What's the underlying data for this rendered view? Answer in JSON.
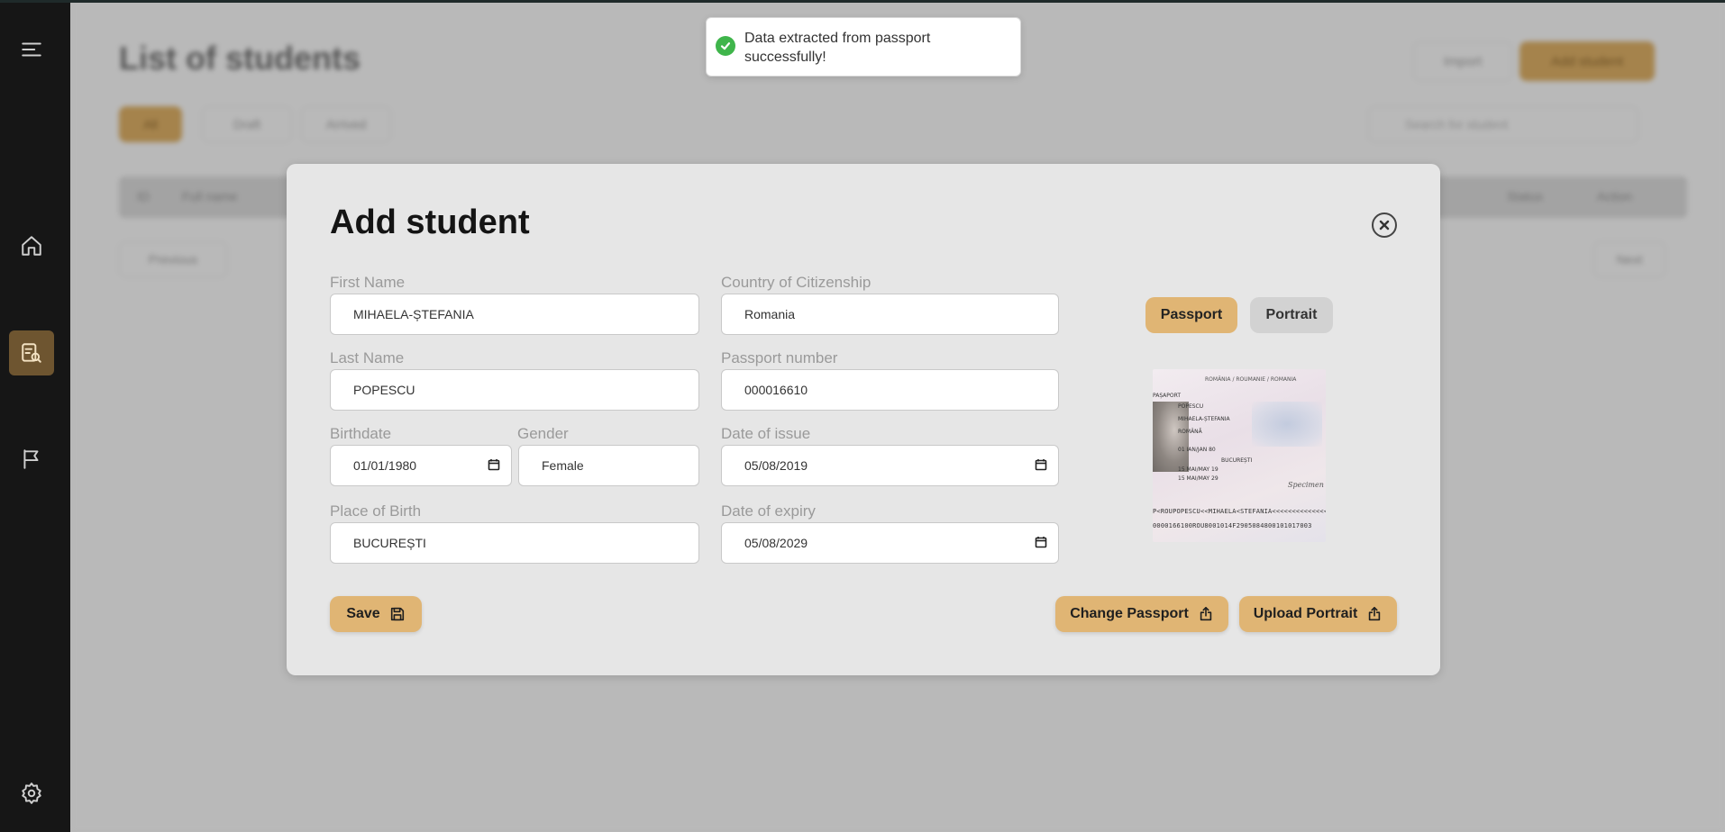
{
  "background": {
    "title": "List of students",
    "import_label": "Import",
    "add_student_label": "Add student",
    "tabs": [
      "All",
      "Draft",
      "Arrived"
    ],
    "search_placeholder": "Search for student",
    "table_headers": [
      "ID",
      "Full name",
      "Status",
      "Action"
    ],
    "row_button": "Previous",
    "pager": "Next"
  },
  "toast": {
    "message": "Data extracted from passport successfully!",
    "icon": "check-circle-icon",
    "icon_color": "#3fb54b"
  },
  "modal": {
    "title": "Add student",
    "fields": {
      "first_name": {
        "label": "First Name",
        "value": "MIHAELA-ȘTEFANIA"
      },
      "last_name": {
        "label": "Last Name",
        "value": "POPESCU"
      },
      "birthdate": {
        "label": "Birthdate",
        "value": "01/01/1980"
      },
      "gender": {
        "label": "Gender",
        "value": "Female"
      },
      "place_of_birth": {
        "label": "Place of Birth",
        "value": "BUCUREȘTI"
      },
      "country": {
        "label": "Country of Citizenship",
        "value": "Romania"
      },
      "passport_number": {
        "label": "Passport number",
        "value": "000016610"
      },
      "date_of_issue": {
        "label": "Date of issue",
        "value": "05/08/2019"
      },
      "date_of_expiry": {
        "label": "Date of expiry",
        "value": "05/08/2029"
      }
    },
    "toggle": {
      "passport": "Passport",
      "portrait": "Portrait",
      "selected": "Passport"
    },
    "passport_image": {
      "header": "ROMÂNIA / ROUMANIE / ROMANIA",
      "label": "PAȘAPORT",
      "surname": "POPESCU",
      "given": "MIHAELA-ȘTEFANIA",
      "nationality": "ROMÂNĂ",
      "dob": "01 IAN/JAN 80",
      "pob": "BUCUREȘTI",
      "issued": "15 MAI/MAY 19",
      "expiry": "15 MAI/MAY 29",
      "specimen": "Specimen",
      "mrz1": "P<ROUPOPESCU<<MIHAELA<STEFANIA<<<<<<<<<<<<<<",
      "mrz2": "0000166100ROU8001014F2905084800101017003"
    },
    "buttons": {
      "save": "Save",
      "change_passport": "Change Passport",
      "upload_portrait": "Upload Portrait"
    },
    "accent_color": "#e0b574"
  }
}
